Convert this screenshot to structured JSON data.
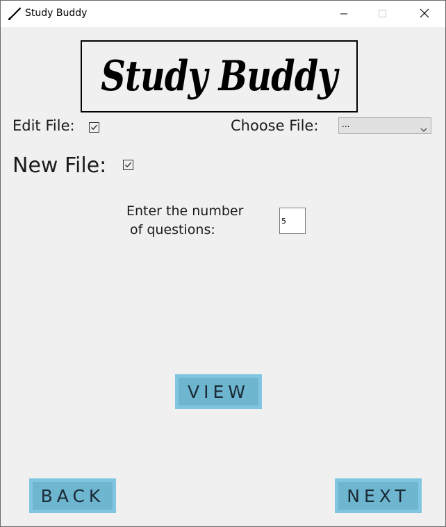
{
  "window": {
    "title": "Study Buddy",
    "app_icon": "pencil-icon",
    "controls": [
      "minimize-icon",
      "maximize-icon",
      "close-icon"
    ]
  },
  "logo": {
    "text": "Study Buddy"
  },
  "edit_file": {
    "label": "Edit File:",
    "checked": true
  },
  "choose_file": {
    "label": "Choose File:",
    "selected": "..."
  },
  "new_file": {
    "label": "New File:",
    "checked": true
  },
  "questions": {
    "label_line1": "Enter the number",
    "label_line2": "of questions:",
    "value": "5"
  },
  "buttons": {
    "view": "VIEW",
    "back": "BACK",
    "next": "NEXT"
  },
  "colors": {
    "button_fill": "#6eb5d0",
    "button_border": "#81c6e0",
    "background": "#f0f0f0"
  }
}
